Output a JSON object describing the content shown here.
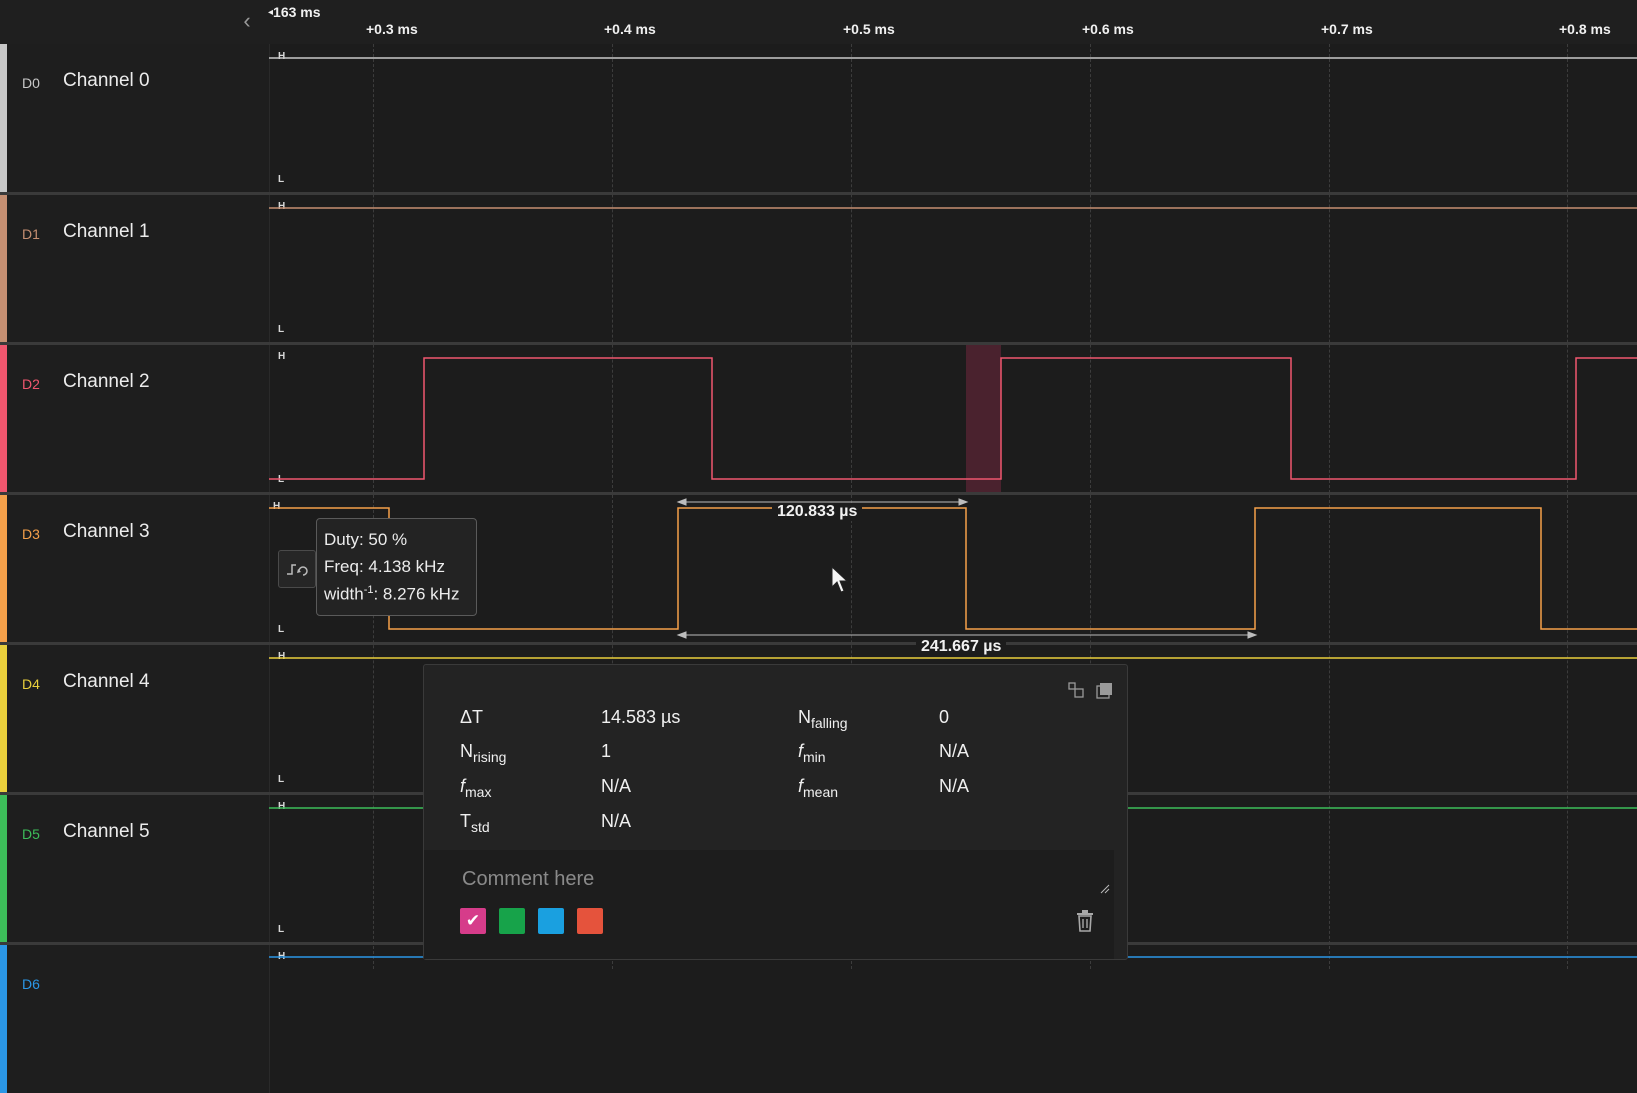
{
  "ruler": {
    "start_time": "163 ms",
    "ticks": [
      "+0.3 ms",
      "+0.4 ms",
      "+0.5 ms",
      "+0.6 ms",
      "+0.7 ms",
      "+0.8 ms"
    ]
  },
  "level_labels": {
    "high": "H",
    "low": "L"
  },
  "channels": [
    {
      "id": "D0",
      "name": "Channel 0",
      "color": "#c8c8c8"
    },
    {
      "id": "D1",
      "name": "Channel 1",
      "color": "#c58f72"
    },
    {
      "id": "D2",
      "name": "Channel 2",
      "color": "#f0566e"
    },
    {
      "id": "D3",
      "name": "Channel 3",
      "color": "#f5a04a"
    },
    {
      "id": "D4",
      "name": "Channel 4",
      "color": "#e9cf3c"
    },
    {
      "id": "D5",
      "name": "Channel 5",
      "color": "#3dbd5a"
    },
    {
      "id": "D6",
      "name": "",
      "color": "#2b97e6"
    }
  ],
  "tooltip": {
    "duty": "Duty: 50 %",
    "freq": "Freq: 4.138 kHz",
    "width_prefix": "width",
    "width_sup": "-1",
    "width_value": ": 8.276 kHz"
  },
  "measurements": {
    "pulse_width": "120.833 µs",
    "period": "241.667 µs"
  },
  "panel": {
    "delta_t": {
      "label": "ΔT",
      "value": "14.583 µs"
    },
    "n_falling": {
      "label": "N",
      "sub": "falling",
      "value": "0"
    },
    "n_rising": {
      "label": "N",
      "sub": "rising",
      "value": "1"
    },
    "f_min": {
      "label": "f",
      "sub": "min",
      "value": "N/A"
    },
    "f_max": {
      "label": "f",
      "sub": "max",
      "value": "N/A"
    },
    "f_mean": {
      "label": "f",
      "sub": "mean",
      "value": "N/A"
    },
    "t_std": {
      "label": "T",
      "sub": "std",
      "value": "N/A"
    },
    "comment_placeholder": "Comment here",
    "swatches": [
      "#d63c8a",
      "#17a34a",
      "#1aa0e0",
      "#e5533c"
    ],
    "selected_swatch": 0
  }
}
